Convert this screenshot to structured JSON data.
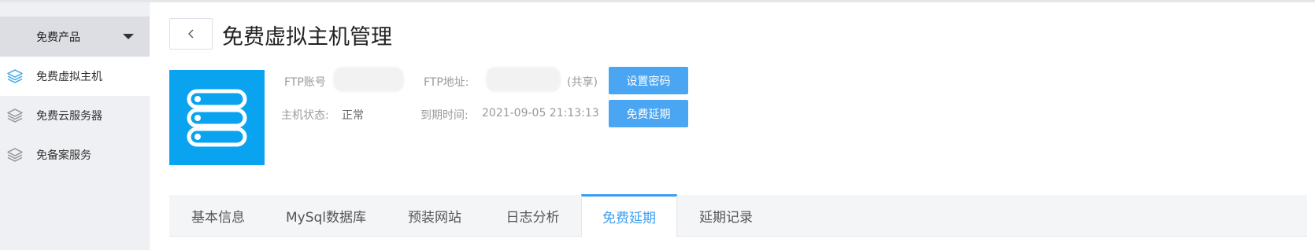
{
  "sidebar": {
    "header_label": "免费产品",
    "items": [
      {
        "label": "免费虚拟主机",
        "active": true
      },
      {
        "label": "免费云服务器",
        "active": false
      },
      {
        "label": "免备案服务",
        "active": false
      }
    ]
  },
  "header": {
    "title": "免费虚拟主机管理"
  },
  "info": {
    "ftp_account_label": "FTP账号",
    "ftp_address_label": "FTP地址:",
    "shared_label": "(共享)",
    "host_status_label": "主机状态:",
    "host_status_value": "正常",
    "expire_label": "到期时间:",
    "expire_value": "2021-09-05 21:13:13"
  },
  "buttons": {
    "set_password": "设置密码",
    "free_extend": "免费延期"
  },
  "tabs": [
    {
      "label": "基本信息",
      "active": false
    },
    {
      "label": "MySql数据库",
      "active": false
    },
    {
      "label": "预装网站",
      "active": false
    },
    {
      "label": "日志分析",
      "active": false
    },
    {
      "label": "免费延期",
      "active": true
    },
    {
      "label": "延期记录",
      "active": false
    }
  ],
  "colors": {
    "accent": "#3a9ef0",
    "button": "#4aa6f3",
    "product_icon_bg": "#0aa3f0"
  }
}
